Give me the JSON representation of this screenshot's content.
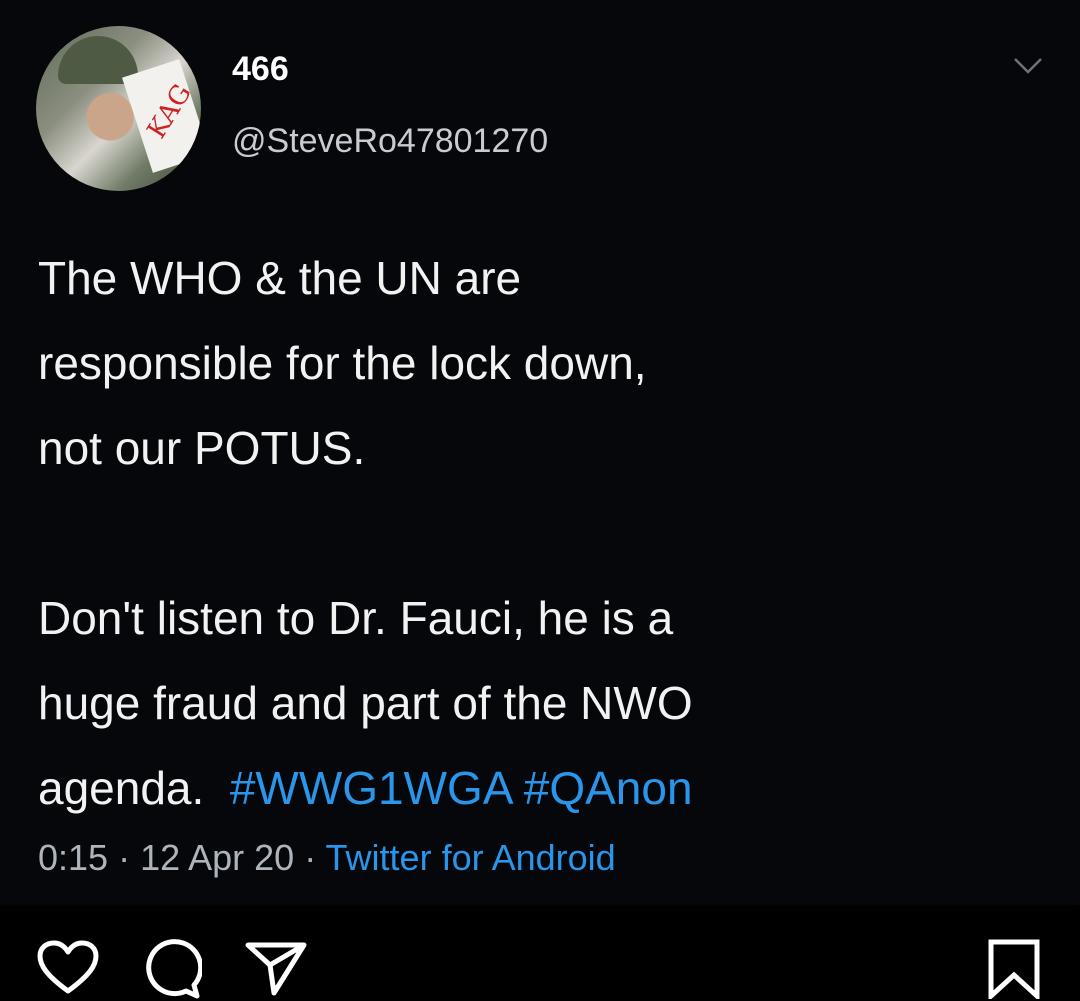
{
  "tweet": {
    "display_name": "466",
    "handle": "@SteveRo47801270",
    "avatar_text": "KAG",
    "body_line1": "The WHO & the UN are",
    "body_line2": "responsible for the lock down,",
    "body_line3": "not our POTUS.",
    "body_line4": "Don't listen to Dr. Fauci, he is a",
    "body_line5": "huge fraud and part of the NWO",
    "body_line6_text": "agenda.",
    "hashtags": [
      "#WWG1WGA",
      "#QAnon"
    ],
    "time": "0:15",
    "date": "12 Apr 20",
    "source": "Twitter for Android"
  },
  "colors": {
    "link": "#2b95e9",
    "background": "#05070b"
  },
  "icons": [
    "chevron-down-icon",
    "heart-icon",
    "comment-icon",
    "share-icon",
    "bookmark-icon"
  ]
}
